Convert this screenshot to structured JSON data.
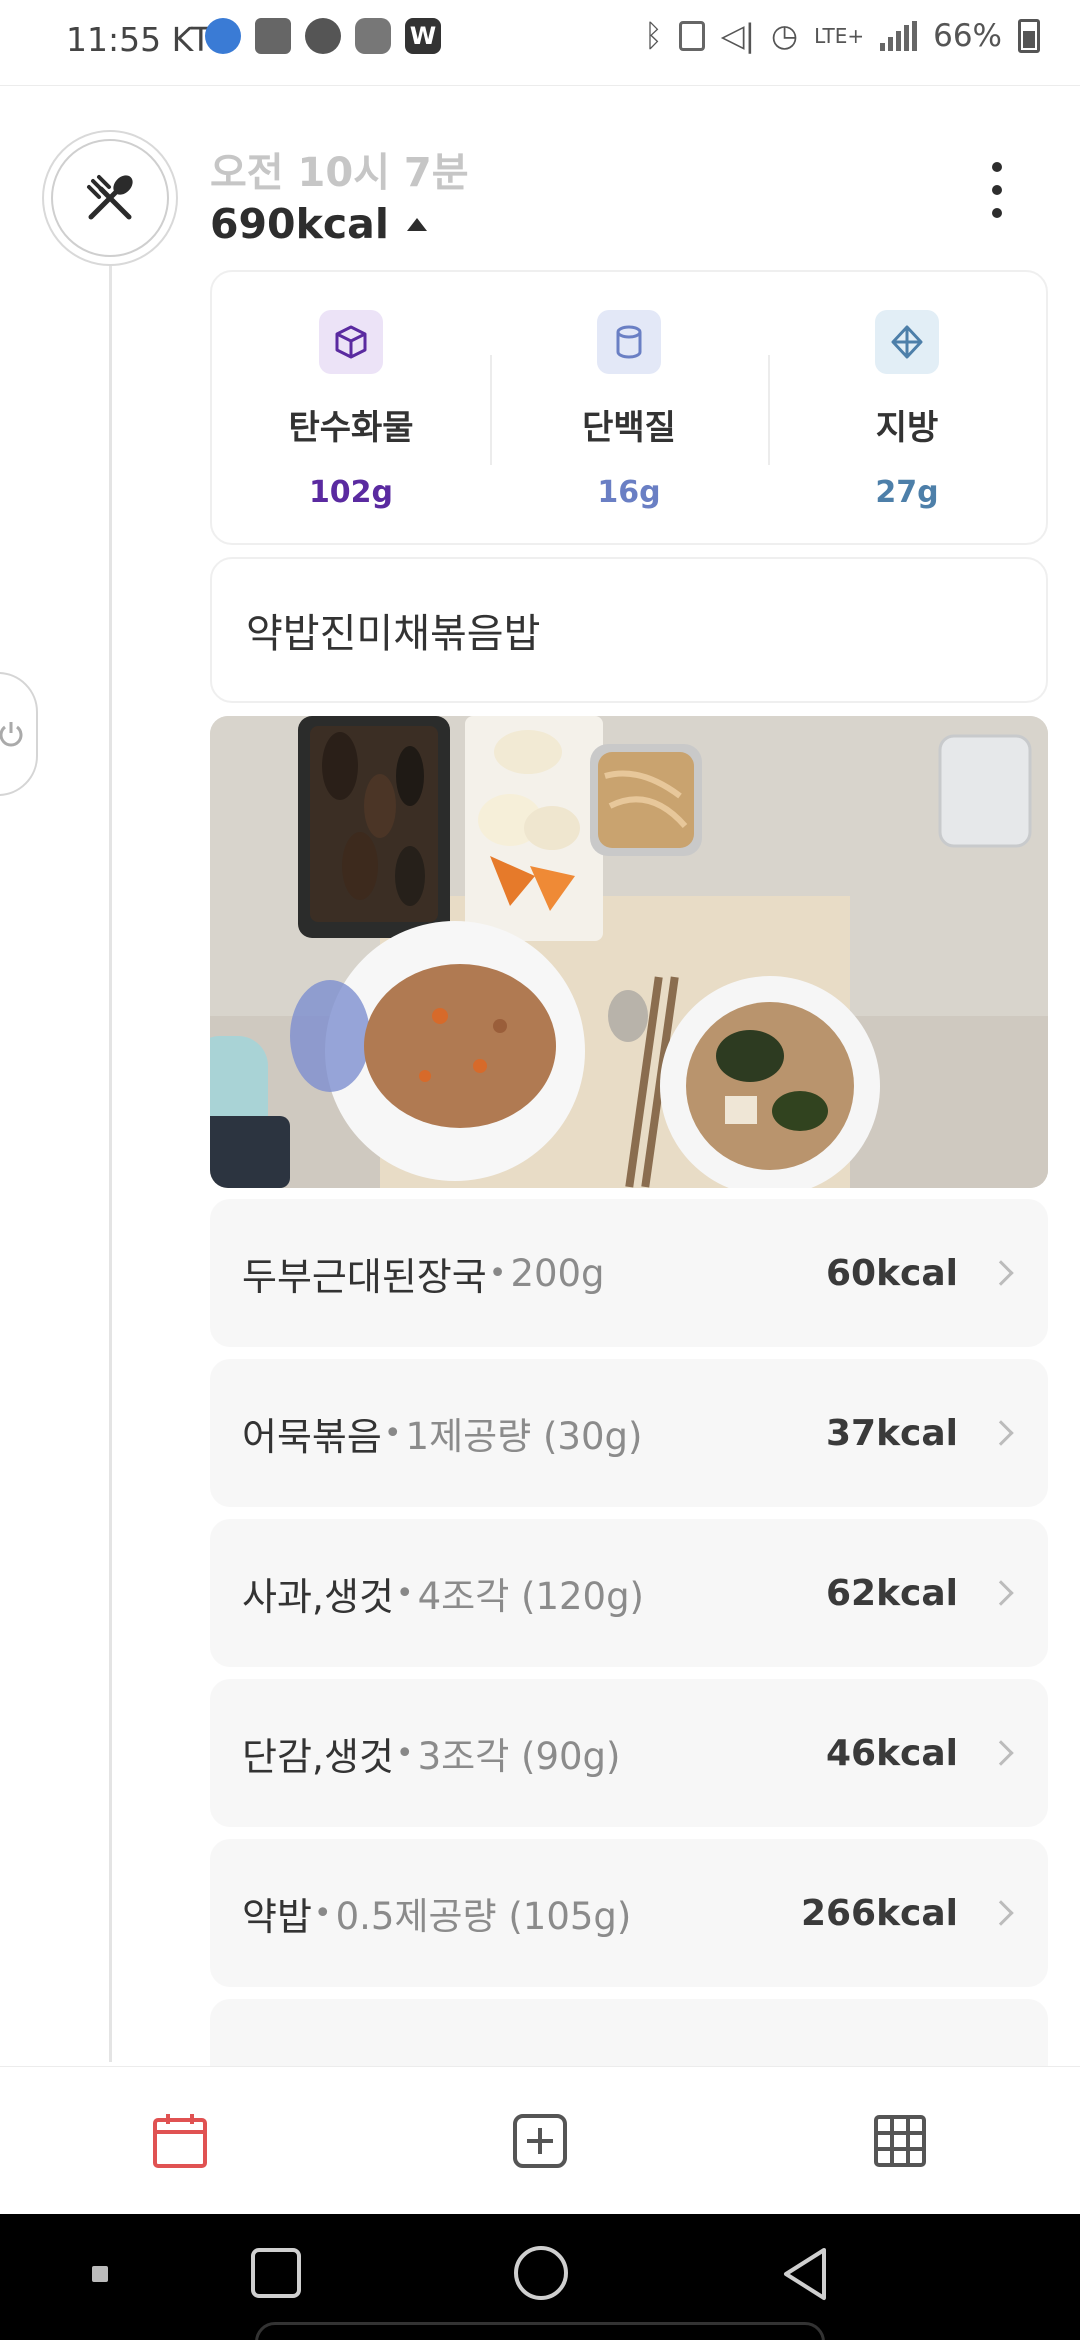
{
  "status_bar": {
    "time": "11:55",
    "carrier": "KT",
    "network": "LTE+",
    "battery": "66%"
  },
  "meal": {
    "time_label": "오전 10시 7분",
    "total_kcal": "690kcal",
    "title": "약밥진미채볶음밥"
  },
  "macros": [
    {
      "name": "탄수화물",
      "value": "102g",
      "color": "#5a2aa0",
      "icon": "cube-icon",
      "icon_bg": "#ece3f7"
    },
    {
      "name": "단백질",
      "value": "16g",
      "color": "#6a7fc4",
      "icon": "cylinder-icon",
      "icon_bg": "#e3e8f7"
    },
    {
      "name": "지방",
      "value": "27g",
      "color": "#4d7fa9",
      "icon": "diamond-icon",
      "icon_bg": "#e2eef6"
    }
  ],
  "foods": [
    {
      "name": "두부근대된장국",
      "dot": "•",
      "portion": "200g",
      "kcal": "60kcal"
    },
    {
      "name": "어묵볶음",
      "dot": "•",
      "portion": "1제공량 (30g)",
      "kcal": "37kcal"
    },
    {
      "name": "사과,생것",
      "dot": "•",
      "portion": "4조각 (120g)",
      "kcal": "62kcal"
    },
    {
      "name": "단감,생것",
      "dot": "•",
      "portion": "3조각 (90g)",
      "kcal": "46kcal"
    },
    {
      "name": "약밥",
      "dot": "•",
      "portion": "0.5제공량 (105g)",
      "kcal": "266kcal"
    }
  ],
  "bottom_nav": [
    {
      "icon": "calendar-icon",
      "active": true,
      "color": "#e05252"
    },
    {
      "icon": "add-square-icon",
      "active": false,
      "color": "#555555"
    },
    {
      "icon": "grid-icon",
      "active": false,
      "color": "#555555"
    }
  ]
}
